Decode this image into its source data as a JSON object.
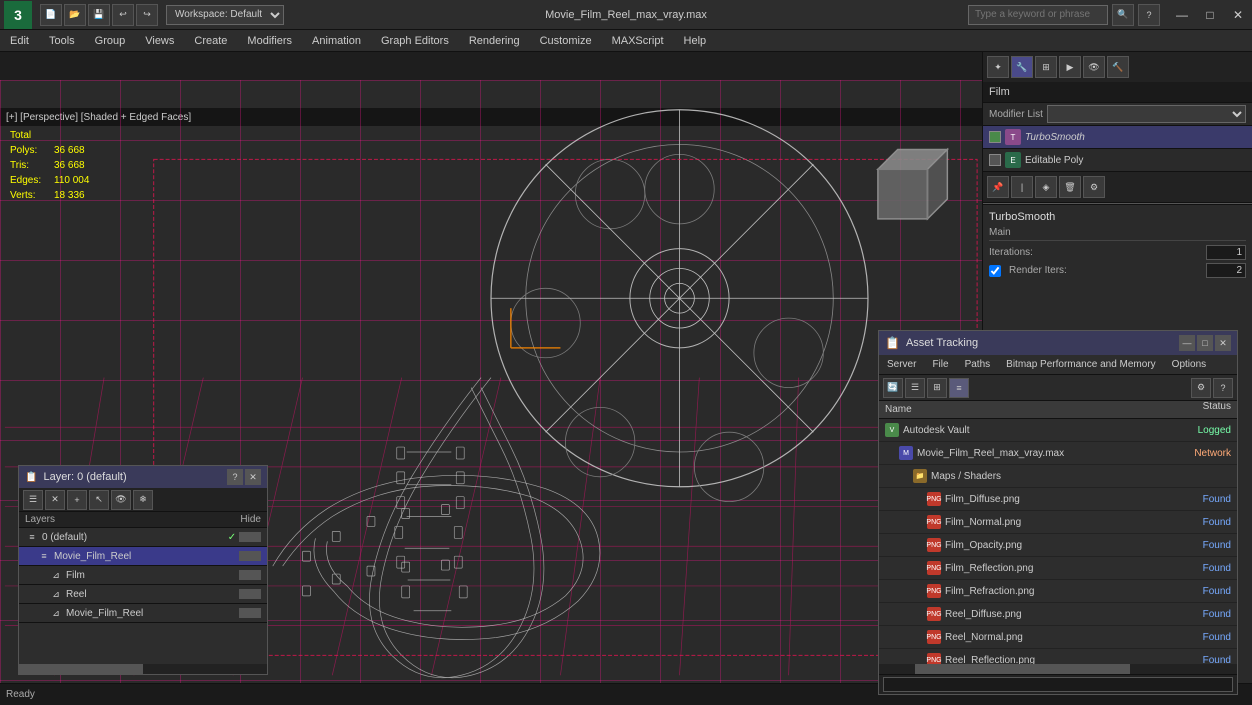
{
  "app": {
    "title": "Movie_Film_Reel_max_vray.max",
    "logo": "3",
    "workspace": "Workspace: Default"
  },
  "titlebar": {
    "minimize": "—",
    "maximize": "□",
    "close": "✕"
  },
  "menubar": {
    "items": [
      "Edit",
      "Tools",
      "Group",
      "Views",
      "Create",
      "Modifiers",
      "Animation",
      "Graph Editors",
      "Rendering",
      "Customize",
      "MAXScript",
      "Help"
    ]
  },
  "viewport": {
    "label": "[+] [Perspective] [Shaded + Edged Faces]",
    "stats": {
      "total_label": "Total",
      "polys_label": "Polys:",
      "polys_value": "36 668",
      "tris_label": "Tris:",
      "tris_value": "36 668",
      "edges_label": "Edges:",
      "edges_value": "110 004",
      "verts_label": "Verts:",
      "verts_value": "18 336"
    }
  },
  "right_panel": {
    "object_name": "Film",
    "modifier_list_label": "Modifier List",
    "modifiers": [
      {
        "name": "TurboSmooth",
        "checked": true,
        "active": true
      },
      {
        "name": "Editable Poly",
        "checked": false,
        "active": false
      }
    ],
    "turbosmooth": {
      "title": "TurboSmooth",
      "section": "Main",
      "iterations_label": "Iterations:",
      "iterations_value": "1",
      "render_iters_label": "Render Iters:",
      "render_iters_value": "2"
    }
  },
  "asset_tracking": {
    "title": "Asset Tracking",
    "menu_items": [
      "Server",
      "File",
      "Paths",
      "Bitmap Performance and Memory",
      "Options"
    ],
    "columns": {
      "name": "Name",
      "status": "Status"
    },
    "rows": [
      {
        "indent": 0,
        "icon": "vault",
        "name": "Autodesk Vault",
        "status": "Logged",
        "status_class": "status-logged"
      },
      {
        "indent": 1,
        "icon": "max",
        "name": "Movie_Film_Reel_max_vray.max",
        "status": "Network",
        "status_class": "status-network"
      },
      {
        "indent": 2,
        "icon": "folder",
        "name": "Maps / Shaders",
        "status": "",
        "status_class": ""
      },
      {
        "indent": 3,
        "icon": "png",
        "name": "Film_Diffuse.png",
        "status": "Found",
        "status_class": "status-found"
      },
      {
        "indent": 3,
        "icon": "png",
        "name": "Film_Normal.png",
        "status": "Found",
        "status_class": "status-found"
      },
      {
        "indent": 3,
        "icon": "png",
        "name": "Film_Opacity.png",
        "status": "Found",
        "status_class": "status-found"
      },
      {
        "indent": 3,
        "icon": "png",
        "name": "Film_Reflection.png",
        "status": "Found",
        "status_class": "status-found"
      },
      {
        "indent": 3,
        "icon": "png",
        "name": "Film_Refraction.png",
        "status": "Found",
        "status_class": "status-found"
      },
      {
        "indent": 3,
        "icon": "png",
        "name": "Reel_Diffuse.png",
        "status": "Found",
        "status_class": "status-found"
      },
      {
        "indent": 3,
        "icon": "png",
        "name": "Reel_Normal.png",
        "status": "Found",
        "status_class": "status-found"
      },
      {
        "indent": 3,
        "icon": "png",
        "name": "Reel_Reflection.png",
        "status": "Found",
        "status_class": "status-found"
      }
    ]
  },
  "layers": {
    "title": "Layer: 0 (default)",
    "columns": {
      "layers": "Layers",
      "hide": "Hide"
    },
    "rows": [
      {
        "indent": 0,
        "name": "0 (default)",
        "checked": true,
        "type": "layer"
      },
      {
        "indent": 1,
        "name": "Movie_Film_Reel",
        "checked": false,
        "type": "layer-active"
      },
      {
        "indent": 2,
        "name": "Film",
        "checked": false,
        "type": "item"
      },
      {
        "indent": 2,
        "name": "Reel",
        "checked": false,
        "type": "item"
      },
      {
        "indent": 2,
        "name": "Movie_Film_Reel",
        "checked": false,
        "type": "item"
      }
    ]
  },
  "toolbar_icons": {
    "undo": "↩",
    "redo": "↪",
    "select": "↖",
    "move": "✛",
    "rotate": "↻",
    "scale": "⤢"
  }
}
